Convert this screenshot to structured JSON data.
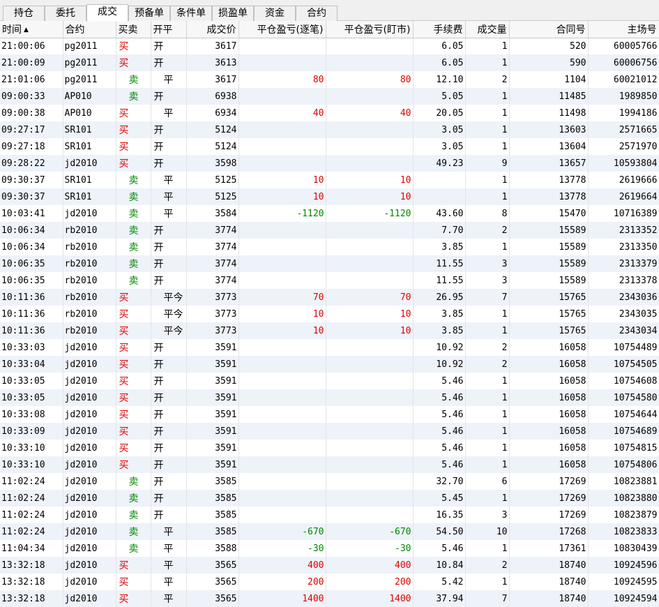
{
  "tabs": [
    {
      "label": "持仓"
    },
    {
      "label": "委托"
    },
    {
      "label": "成交",
      "active": true
    },
    {
      "label": "预备单"
    },
    {
      "label": "条件单"
    },
    {
      "label": "损盈单"
    },
    {
      "label": "资金"
    },
    {
      "label": "合约"
    }
  ],
  "table": {
    "columns": [
      "时间",
      "合约",
      "买卖",
      "开平",
      "成交价",
      "平仓盈亏(逐笔)",
      "平仓盈亏(盯市)",
      "手续费",
      "成交量",
      "合同号",
      "主场号"
    ],
    "sort_indicator": "▲",
    "rows": [
      [
        "21:00:06",
        "pg2011",
        "买",
        "开",
        "3617",
        "",
        "",
        "6.05",
        "1",
        "520",
        "60005766"
      ],
      [
        "21:00:09",
        "pg2011",
        "买",
        "开",
        "3613",
        "",
        "",
        "6.05",
        "1",
        "590",
        "60006756"
      ],
      [
        "21:01:06",
        "pg2011",
        "卖",
        "平",
        "3617",
        "80",
        "80",
        "12.10",
        "2",
        "1104",
        "60021012"
      ],
      [
        "09:00:33",
        "AP010",
        "卖",
        "开",
        "6938",
        "",
        "",
        "5.05",
        "1",
        "11485",
        "1989850"
      ],
      [
        "09:00:38",
        "AP010",
        "买",
        "平",
        "6934",
        "40",
        "40",
        "20.05",
        "1",
        "11498",
        "1994186"
      ],
      [
        "09:27:17",
        "SR101",
        "买",
        "开",
        "5124",
        "",
        "",
        "3.05",
        "1",
        "13603",
        "2571665"
      ],
      [
        "09:27:18",
        "SR101",
        "买",
        "开",
        "5124",
        "",
        "",
        "3.05",
        "1",
        "13604",
        "2571970"
      ],
      [
        "09:28:22",
        "jd2010",
        "买",
        "开",
        "3598",
        "",
        "",
        "49.23",
        "9",
        "13657",
        "10593804"
      ],
      [
        "09:30:37",
        "SR101",
        "卖",
        "平",
        "5125",
        "10",
        "10",
        "",
        "1",
        "13778",
        "2619666"
      ],
      [
        "09:30:37",
        "SR101",
        "卖",
        "平",
        "5125",
        "10",
        "10",
        "",
        "1",
        "13778",
        "2619664"
      ],
      [
        "10:03:41",
        "jd2010",
        "卖",
        "平",
        "3584",
        "-1120",
        "-1120",
        "43.60",
        "8",
        "15470",
        "10716389"
      ],
      [
        "10:06:34",
        "rb2010",
        "卖",
        "开",
        "3774",
        "",
        "",
        "7.70",
        "2",
        "15589",
        "2313352"
      ],
      [
        "10:06:34",
        "rb2010",
        "卖",
        "开",
        "3774",
        "",
        "",
        "3.85",
        "1",
        "15589",
        "2313350"
      ],
      [
        "10:06:35",
        "rb2010",
        "卖",
        "开",
        "3774",
        "",
        "",
        "11.55",
        "3",
        "15589",
        "2313379"
      ],
      [
        "10:06:35",
        "rb2010",
        "卖",
        "开",
        "3774",
        "",
        "",
        "11.55",
        "3",
        "15589",
        "2313378"
      ],
      [
        "10:11:36",
        "rb2010",
        "买",
        "平今",
        "3773",
        "70",
        "70",
        "26.95",
        "7",
        "15765",
        "2343036"
      ],
      [
        "10:11:36",
        "rb2010",
        "买",
        "平今",
        "3773",
        "10",
        "10",
        "3.85",
        "1",
        "15765",
        "2343035"
      ],
      [
        "10:11:36",
        "rb2010",
        "买",
        "平今",
        "3773",
        "10",
        "10",
        "3.85",
        "1",
        "15765",
        "2343034"
      ],
      [
        "10:33:03",
        "jd2010",
        "买",
        "开",
        "3591",
        "",
        "",
        "10.92",
        "2",
        "16058",
        "10754489"
      ],
      [
        "10:33:04",
        "jd2010",
        "买",
        "开",
        "3591",
        "",
        "",
        "10.92",
        "2",
        "16058",
        "10754505"
      ],
      [
        "10:33:05",
        "jd2010",
        "买",
        "开",
        "3591",
        "",
        "",
        "5.46",
        "1",
        "16058",
        "10754608"
      ],
      [
        "10:33:05",
        "jd2010",
        "买",
        "开",
        "3591",
        "",
        "",
        "5.46",
        "1",
        "16058",
        "10754580"
      ],
      [
        "10:33:08",
        "jd2010",
        "买",
        "开",
        "3591",
        "",
        "",
        "5.46",
        "1",
        "16058",
        "10754644"
      ],
      [
        "10:33:09",
        "jd2010",
        "买",
        "开",
        "3591",
        "",
        "",
        "5.46",
        "1",
        "16058",
        "10754689"
      ],
      [
        "10:33:10",
        "jd2010",
        "买",
        "开",
        "3591",
        "",
        "",
        "5.46",
        "1",
        "16058",
        "10754815"
      ],
      [
        "10:33:10",
        "jd2010",
        "买",
        "开",
        "3591",
        "",
        "",
        "5.46",
        "1",
        "16058",
        "10754806"
      ],
      [
        "11:02:24",
        "jd2010",
        "卖",
        "开",
        "3585",
        "",
        "",
        "32.70",
        "6",
        "17269",
        "10823881"
      ],
      [
        "11:02:24",
        "jd2010",
        "卖",
        "开",
        "3585",
        "",
        "",
        "5.45",
        "1",
        "17269",
        "10823880"
      ],
      [
        "11:02:24",
        "jd2010",
        "卖",
        "开",
        "3585",
        "",
        "",
        "16.35",
        "3",
        "17269",
        "10823879"
      ],
      [
        "11:02:24",
        "jd2010",
        "卖",
        "平",
        "3585",
        "-670",
        "-670",
        "54.50",
        "10",
        "17268",
        "10823833"
      ],
      [
        "11:04:34",
        "jd2010",
        "卖",
        "平",
        "3588",
        "-30",
        "-30",
        "5.46",
        "1",
        "17361",
        "10830439"
      ],
      [
        "13:32:18",
        "jd2010",
        "买",
        "平",
        "3565",
        "400",
        "400",
        "10.84",
        "2",
        "18740",
        "10924596"
      ],
      [
        "13:32:18",
        "jd2010",
        "买",
        "平",
        "3565",
        "200",
        "200",
        "5.42",
        "1",
        "18740",
        "10924595"
      ],
      [
        "13:32:18",
        "jd2010",
        "买",
        "平",
        "3565",
        "1400",
        "1400",
        "37.94",
        "7",
        "18740",
        "10924594"
      ]
    ]
  },
  "colors": {
    "buy": "#e00000",
    "sell": "#008800",
    "row_alt": "#eef2f9"
  }
}
